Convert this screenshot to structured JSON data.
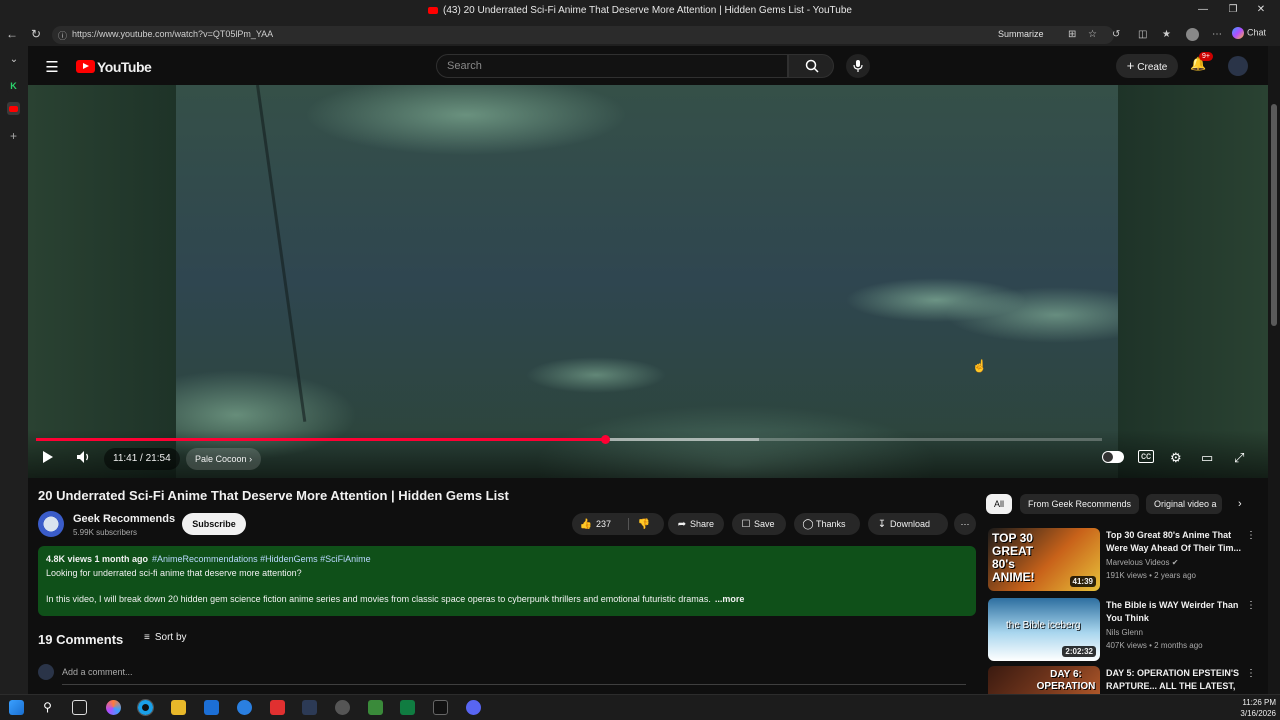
{
  "browser": {
    "window_title": "(43) 20 Underrated Sci-Fi Anime That Deserve More Attention | Hidden Gems List - YouTube",
    "url": "https://www.youtube.com/watch?v=QT05lPm_YAA",
    "summarize_label": "Summarize",
    "chat_label": "Chat"
  },
  "youtube": {
    "logo_text": "YouTube",
    "search_placeholder": "Search",
    "create_label": "Create",
    "notifications_badge": "9+"
  },
  "player": {
    "time_current": "11:41",
    "time_total": "21:54",
    "time_display": "11:41 / 21:54",
    "progress_fraction": 0.534,
    "buffered_fraction": 0.678,
    "chapter": "Pale Cocoon"
  },
  "video": {
    "title": "20 Underrated Sci-Fi Anime That Deserve More Attention | Hidden Gems List",
    "channel": "Geek Recommends",
    "subscribers": "5.99K subscribers",
    "subscribe_label": "Subscribe",
    "likes": "237",
    "share_label": "Share",
    "save_label": "Save",
    "thanks_label": "Thanks",
    "download_label": "Download",
    "views_date": "4.8K views  1 month ago",
    "hashtags": "#AnimeRecommendations #HiddenGems #SciFiAnime",
    "desc_line1": "Looking for underrated sci-fi anime that deserve more attention?",
    "desc_line2": "In this video, I will break down 20 hidden gem science fiction anime series and movies from classic space operas to cyberpunk thrillers and emotional futuristic dramas.",
    "more_label": "...more"
  },
  "comments": {
    "count_label": "19 Comments",
    "sort_label": "Sort by",
    "add_placeholder": "Add a comment..."
  },
  "sidebar": {
    "chips": [
      "All",
      "From Geek Recommends",
      "Original video a"
    ],
    "recommendations": [
      {
        "title": "Top 30 Great 80's Anime That Were Way Ahead Of Their Tim...",
        "channel": "Marvelous Videos",
        "verified": true,
        "stats": "191K views • 2 years ago",
        "duration": "41:39",
        "thumb_text": "TOP 30 GREAT 80's ANIME!",
        "thumb_color": "#c8621a"
      },
      {
        "title": "The Bible is WAY Weirder Than You Think",
        "channel": "Nils Glenn",
        "verified": false,
        "stats": "407K views • 2 months ago",
        "duration": "2:02:32",
        "thumb_text": "the Bible iceberg",
        "thumb_color": "#4a8fb8"
      },
      {
        "title": "DAY 5: OPERATION EPSTEIN'S RAPTURE... ALL THE LATEST, ...",
        "channel": "",
        "verified": false,
        "stats": "",
        "duration": "",
        "thumb_text": "DAY 6: OPERATION",
        "thumb_color": "#7a3a1e"
      }
    ]
  },
  "taskbar": {
    "time": "11:26 PM",
    "date": "3/16/2026"
  },
  "colors": {
    "youtube_red": "#ff0000",
    "progress_red": "#ff0033",
    "description_bg": "#0f5019",
    "page_bg": "#0f0f0f"
  }
}
